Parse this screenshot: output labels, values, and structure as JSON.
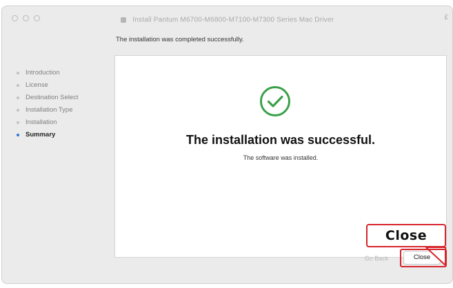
{
  "window": {
    "title": "Install Pantum M6700-M6800-M7100-M7300 Series Mac Driver",
    "title_edge": "£"
  },
  "heading": "The installation was completed successfully.",
  "sidebar": {
    "steps": [
      {
        "label": "Introduction",
        "active": false
      },
      {
        "label": "License",
        "active": false
      },
      {
        "label": "Destination Select",
        "active": false
      },
      {
        "label": "Installation Type",
        "active": false
      },
      {
        "label": "Installation",
        "active": false
      },
      {
        "label": "Summary",
        "active": true
      }
    ]
  },
  "content": {
    "icon": "checkmark-circle-icon",
    "title": "The installation was successful.",
    "subtitle": "The software was installed."
  },
  "buttons": {
    "go_back": "Go Back",
    "close": "Close"
  },
  "callout": {
    "label": "Close"
  },
  "colors": {
    "success_green": "#3aa047",
    "callout_red": "#d6232a",
    "active_bullet": "#2a76d6"
  }
}
